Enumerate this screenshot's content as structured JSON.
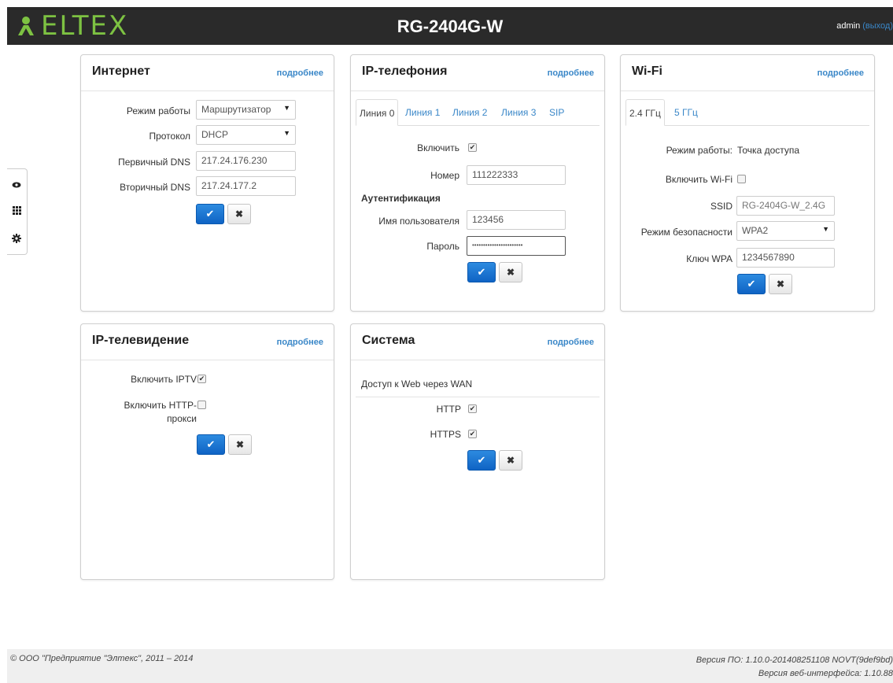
{
  "header": {
    "logo_text": "ELTEX",
    "device": "RG-2404G-W",
    "user": "admin",
    "logout": "(выход)"
  },
  "sidebar": {
    "icons": [
      "eye-icon",
      "grid-icon",
      "gear-icon"
    ]
  },
  "internet": {
    "title": "Интернет",
    "more": "подробнее",
    "mode_label": "Режим работы",
    "mode_value": "Маршрутизатор",
    "protocol_label": "Протокол",
    "protocol_value": "DHCP",
    "dns1_label": "Первичный DNS",
    "dns1_value": "217.24.176.230",
    "dns2_label": "Вторичный DNS",
    "dns2_value": "217.24.177.2"
  },
  "voip": {
    "title": "IP-телефония",
    "more": "подробнее",
    "tabs": [
      "Линия 0",
      "Линия 1",
      "Линия 2",
      "Линия 3",
      "SIP"
    ],
    "enable_label": "Включить",
    "enable_checked": true,
    "number_label": "Номер",
    "number_value": "111222333",
    "auth_heading": "Аутентификация",
    "user_label": "Имя пользователя",
    "user_value": "123456",
    "password_label": "Пароль",
    "password_value": "•••••••••••••••••••••••"
  },
  "wifi": {
    "title": "Wi-Fi",
    "more": "подробнее",
    "tabs": [
      "2.4 ГГц",
      "5 ГГц"
    ],
    "mode_label": "Режим работы:",
    "mode_value": "Точка доступа",
    "enable_label": "Включить Wi-Fi",
    "enable_checked": false,
    "ssid_label": "SSID",
    "ssid_value": "RG-2404G-W_2.4G",
    "security_label": "Режим безопасности",
    "security_value": "WPA2",
    "key_label": "Ключ WPA",
    "key_value": "1234567890"
  },
  "iptv": {
    "title": "IP-телевидение",
    "more": "подробнее",
    "enable_label": "Включить IPTV",
    "enable_checked": true,
    "proxy_label_1": "Включить HTTP-",
    "proxy_label_2": "прокси",
    "proxy_checked": false
  },
  "system": {
    "title": "Система",
    "more": "подробнее",
    "web_access": "Доступ к Web через WAN",
    "http_label": "HTTP",
    "http_checked": true,
    "https_label": "HTTPS",
    "https_checked": true
  },
  "buttons": {
    "ok": "✔",
    "cancel": "✖"
  },
  "footer": {
    "copyright": "© ООО \"Предприятие \"Элтекс\", 2011 – 2014",
    "fw_version": "Версия ПО: 1.10.0-201408251108 NOVT(9def9bd)",
    "web_version": "Версия веб-интерфейса: 1.10.88"
  }
}
